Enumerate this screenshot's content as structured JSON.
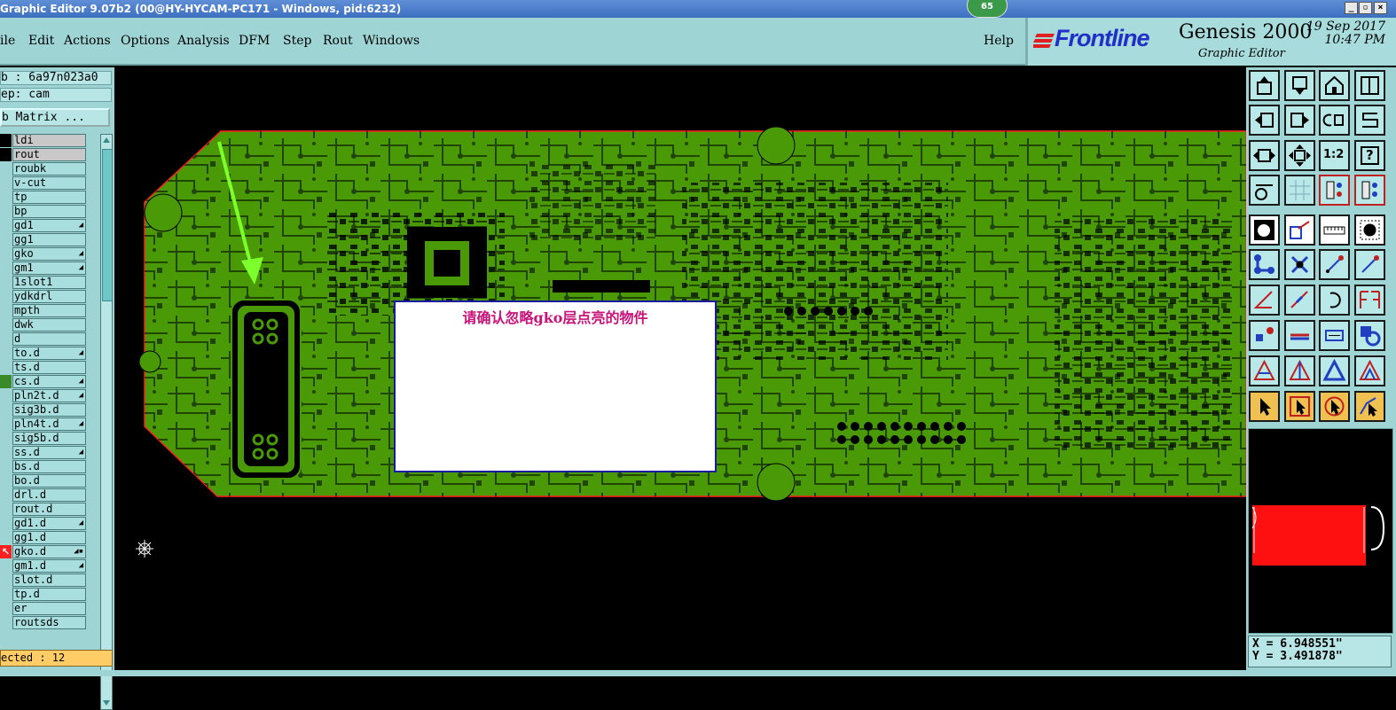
{
  "window": {
    "title": "Graphic Editor 9.07b2 (00@HY-HYCAM-PC171 - Windows, pid:6232)",
    "badge": "65",
    "min": "_",
    "max": "▫",
    "close": "×"
  },
  "menu": {
    "items": [
      "ile",
      "Edit",
      "Actions",
      "Options",
      "Analysis",
      "DFM",
      "Step",
      "Rout",
      "Windows"
    ],
    "help": "Help"
  },
  "brand": {
    "logo": "Frontline",
    "product": "Genesis 2000",
    "subtitle": "Graphic Editor",
    "date": "19 Sep 2017",
    "time": "10:47 PM"
  },
  "job": {
    "job_line": "b : 6a97n023a0",
    "step_line": "ep: cam",
    "matrix_button": "b Matrix ...",
    "selected": "ected : 12"
  },
  "layers": [
    {
      "name": "ldi",
      "highlight": true,
      "color": "#000000",
      "icon": ""
    },
    {
      "name": "rout",
      "highlight": true,
      "color": "#000000",
      "icon": ""
    },
    {
      "name": "roubk",
      "highlight": false,
      "color": "#9fd4d4",
      "icon": ""
    },
    {
      "name": "v-cut",
      "highlight": false,
      "color": "#9fd4d4",
      "icon": ""
    },
    {
      "name": "tp",
      "highlight": false,
      "color": "#9fd4d4",
      "icon": ""
    },
    {
      "name": "bp",
      "highlight": false,
      "color": "#9fd4d4",
      "icon": ""
    },
    {
      "name": "gd1",
      "highlight": false,
      "color": "#9fd4d4",
      "icon": "◢"
    },
    {
      "name": "gg1",
      "highlight": false,
      "color": "#9fd4d4",
      "icon": ""
    },
    {
      "name": "gko",
      "highlight": false,
      "color": "#9fd4d4",
      "icon": "◢"
    },
    {
      "name": "gm1",
      "highlight": false,
      "color": "#9fd4d4",
      "icon": "◢"
    },
    {
      "name": "1slot1",
      "highlight": false,
      "color": "#9fd4d4",
      "icon": ""
    },
    {
      "name": "ydkdrl",
      "highlight": false,
      "color": "#9fd4d4",
      "icon": ""
    },
    {
      "name": "mpth",
      "highlight": false,
      "color": "#9fd4d4",
      "icon": ""
    },
    {
      "name": "dwk",
      "highlight": false,
      "color": "#9fd4d4",
      "icon": ""
    },
    {
      "name": "d",
      "highlight": false,
      "color": "#9fd4d4",
      "icon": ""
    },
    {
      "name": "to.d",
      "highlight": false,
      "color": "#9fd4d4",
      "icon": "◢"
    },
    {
      "name": "ts.d",
      "highlight": false,
      "color": "#9fd4d4",
      "icon": ""
    },
    {
      "name": "cs.d",
      "highlight": false,
      "color": "#3a8a2a",
      "icon": "◢"
    },
    {
      "name": "pln2t.d",
      "highlight": false,
      "color": "#9fd4d4",
      "icon": "◢"
    },
    {
      "name": "sig3b.d",
      "highlight": false,
      "color": "#9fd4d4",
      "icon": ""
    },
    {
      "name": "pln4t.d",
      "highlight": false,
      "color": "#9fd4d4",
      "icon": "◢"
    },
    {
      "name": "sig5b.d",
      "highlight": false,
      "color": "#9fd4d4",
      "icon": ""
    },
    {
      "name": "ss.d",
      "highlight": false,
      "color": "#9fd4d4",
      "icon": "◢"
    },
    {
      "name": "bs.d",
      "highlight": false,
      "color": "#9fd4d4",
      "icon": ""
    },
    {
      "name": "bo.d",
      "highlight": false,
      "color": "#9fd4d4",
      "icon": ""
    },
    {
      "name": "drl.d",
      "highlight": false,
      "color": "#9fd4d4",
      "icon": ""
    },
    {
      "name": "rout.d",
      "highlight": false,
      "color": "#9fd4d4",
      "icon": ""
    },
    {
      "name": "gd1.d",
      "highlight": false,
      "color": "#9fd4d4",
      "icon": "◢"
    },
    {
      "name": "gg1.d",
      "highlight": false,
      "color": "#9fd4d4",
      "icon": ""
    },
    {
      "name": "gko.d",
      "highlight": false,
      "color": "#ff2020",
      "icon": "◢▪"
    },
    {
      "name": "gm1.d",
      "highlight": false,
      "color": "#9fd4d4",
      "icon": "◢"
    },
    {
      "name": "slot.d",
      "highlight": false,
      "color": "#9fd4d4",
      "icon": ""
    },
    {
      "name": "tp.d",
      "highlight": false,
      "color": "#9fd4d4",
      "icon": ""
    },
    {
      "name": "er",
      "highlight": false,
      "color": "#9fd4d4",
      "icon": ""
    },
    {
      "name": "routsds",
      "highlight": false,
      "color": "#9fd4d4",
      "icon": ""
    }
  ],
  "dialog": {
    "message": "请确认忽略gko层点亮的物件"
  },
  "tools": {
    "ratio_label": "1:2",
    "help_label": "?"
  },
  "coords": {
    "x": "X = 6.948551\"",
    "y": "Y = 3.491878\""
  },
  "colors": {
    "board": "#4a9a08",
    "board_outline": "#ff2020",
    "arrow": "#7cff2a",
    "panel": "#9fd4d4",
    "dialog_text": "#c8147a"
  }
}
